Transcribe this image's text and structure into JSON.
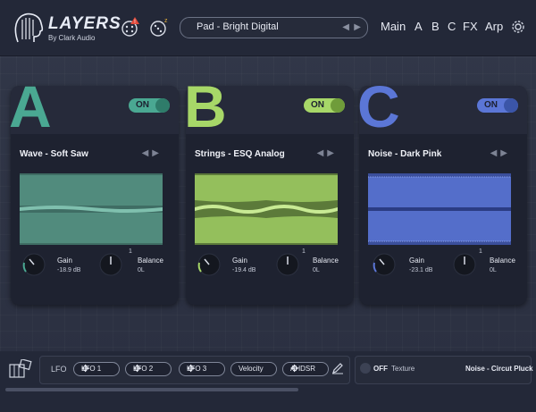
{
  "header": {
    "brand": "LAYERS",
    "byline": "By Clark Audio",
    "preset": "Pad - Bright Digital",
    "nav": [
      "Main",
      "A",
      "B",
      "C",
      "FX",
      "Arp"
    ]
  },
  "layers": [
    {
      "letter": "A",
      "color": "#4aa892",
      "toggle": "ON",
      "wave_name": "Wave - Soft Saw",
      "gain_label": "Gain",
      "gain_value": "-18.9 dB",
      "balance_label": "Balance",
      "balance_value": "0L",
      "balance_marker": "1"
    },
    {
      "letter": "B",
      "color": "#a7d768",
      "toggle": "ON",
      "wave_name": "Strings - ESQ Analog",
      "gain_label": "Gain",
      "gain_value": "-19.4 dB",
      "balance_label": "Balance",
      "balance_value": "0L",
      "balance_marker": "1"
    },
    {
      "letter": "C",
      "color": "#5b76d6",
      "toggle": "ON",
      "wave_name": "Noise - Dark Pink",
      "gain_label": "Gain",
      "gain_value": "-23.1 dB",
      "balance_label": "Balance",
      "balance_value": "0L",
      "balance_marker": "1"
    }
  ],
  "modulation": {
    "title": "LFO",
    "slots": [
      "LFO 1",
      "LFO 2",
      "LFO 3",
      "Velocity",
      "AHDSR"
    ]
  },
  "texture": {
    "toggle": "OFF",
    "label": "Texture",
    "preset": "Noise - Circut Pluck"
  },
  "icons": {
    "logo": "head-profile-icon",
    "dice": "dice-warning-icon",
    "random": "random-dice-icon",
    "settings": "gear-icon",
    "keyboard": "piano-icon",
    "edit": "pencil-icon"
  }
}
